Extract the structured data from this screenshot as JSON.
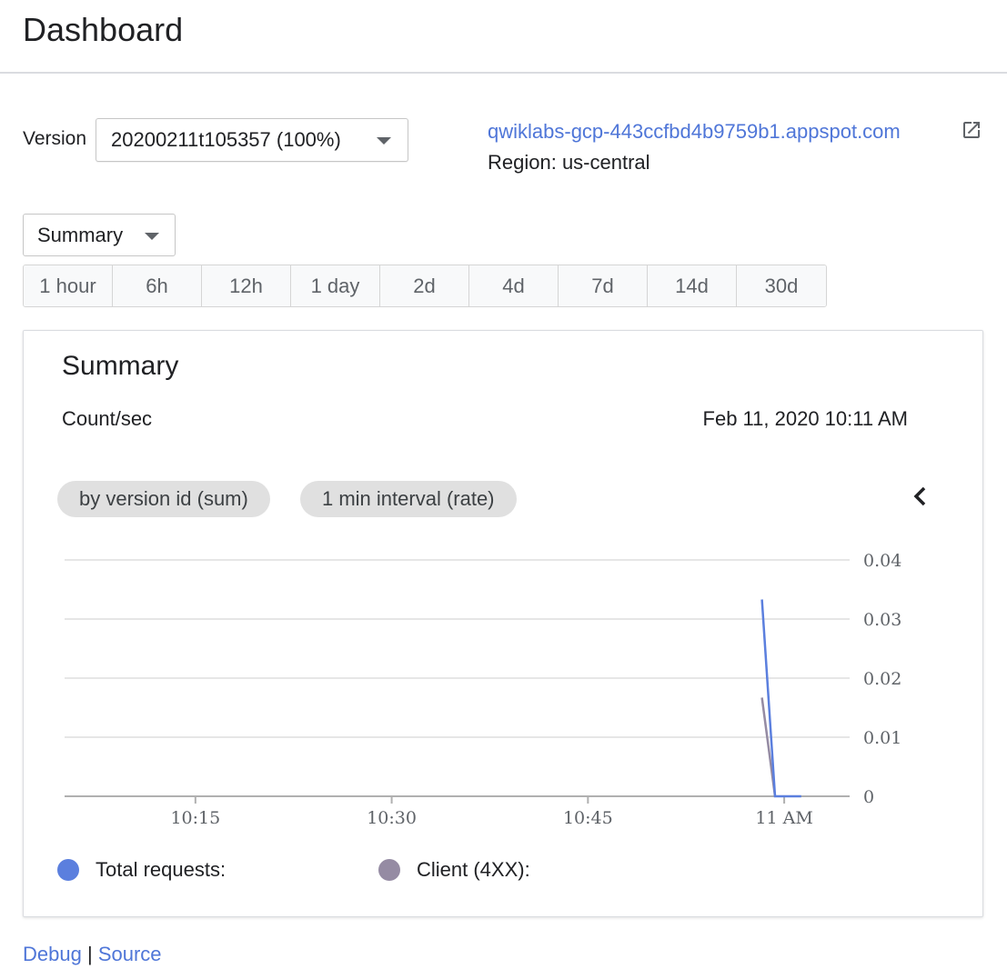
{
  "header": {
    "title": "Dashboard"
  },
  "version": {
    "label": "Version",
    "selected": "20200211t105357 (100%)"
  },
  "app": {
    "url_text": "qwiklabs-gcp-443ccfbd4b9759b1.appspot.com",
    "region": "Region: us-central"
  },
  "view_select": {
    "selected": "Summary"
  },
  "time_ranges": [
    "1 hour",
    "6h",
    "12h",
    "1 day",
    "2d",
    "4d",
    "7d",
    "14d",
    "30d"
  ],
  "card": {
    "title": "Summary",
    "unit": "Count/sec",
    "timestamp": "Feb 11, 2020 10:11 AM",
    "chips": [
      "by version id (sum)",
      "1 min interval (rate)"
    ]
  },
  "colors": {
    "link": "#4f76d8",
    "total_requests": "#5b7fde",
    "client_4xx": "#958ba3",
    "gridline": "#e6e6e6"
  },
  "chart_data": {
    "type": "line",
    "x_ticks": [
      "10:15",
      "10:30",
      "10:45",
      "11 AM"
    ],
    "y_ticks": [
      "0.04",
      "0.03",
      "0.02",
      "0.01",
      "0"
    ],
    "ylim": [
      0,
      0.04
    ],
    "x_range_minutes": [
      5,
      65
    ],
    "series": [
      {
        "name": "Total requests:",
        "points": [
          [
            58.3,
            0.0333
          ],
          [
            59.3,
            0
          ],
          [
            61.3,
            0
          ]
        ]
      },
      {
        "name": "Client (4XX):",
        "points": [
          [
            58.3,
            0.0167
          ],
          [
            59.3,
            0
          ]
        ]
      }
    ]
  },
  "footer": {
    "debug": "Debug",
    "separator": "|",
    "source": "Source"
  }
}
